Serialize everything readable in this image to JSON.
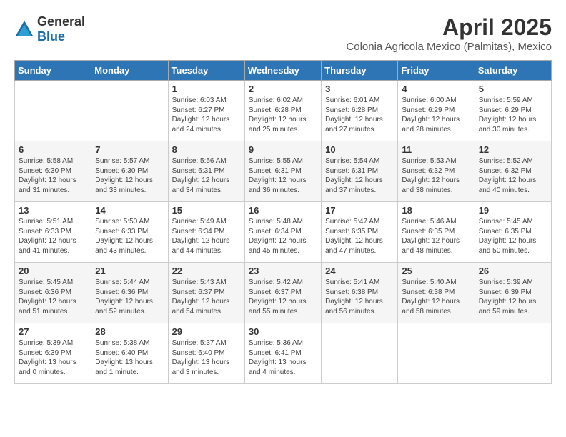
{
  "header": {
    "logo_general": "General",
    "logo_blue": "Blue",
    "month_title": "April 2025",
    "location": "Colonia Agricola Mexico (Palmitas), Mexico"
  },
  "weekdays": [
    "Sunday",
    "Monday",
    "Tuesday",
    "Wednesday",
    "Thursday",
    "Friday",
    "Saturday"
  ],
  "weeks": [
    [
      {
        "day": "",
        "sunrise": "",
        "sunset": "",
        "daylight": ""
      },
      {
        "day": "",
        "sunrise": "",
        "sunset": "",
        "daylight": ""
      },
      {
        "day": "1",
        "sunrise": "Sunrise: 6:03 AM",
        "sunset": "Sunset: 6:27 PM",
        "daylight": "Daylight: 12 hours and 24 minutes."
      },
      {
        "day": "2",
        "sunrise": "Sunrise: 6:02 AM",
        "sunset": "Sunset: 6:28 PM",
        "daylight": "Daylight: 12 hours and 25 minutes."
      },
      {
        "day": "3",
        "sunrise": "Sunrise: 6:01 AM",
        "sunset": "Sunset: 6:28 PM",
        "daylight": "Daylight: 12 hours and 27 minutes."
      },
      {
        "day": "4",
        "sunrise": "Sunrise: 6:00 AM",
        "sunset": "Sunset: 6:29 PM",
        "daylight": "Daylight: 12 hours and 28 minutes."
      },
      {
        "day": "5",
        "sunrise": "Sunrise: 5:59 AM",
        "sunset": "Sunset: 6:29 PM",
        "daylight": "Daylight: 12 hours and 30 minutes."
      }
    ],
    [
      {
        "day": "6",
        "sunrise": "Sunrise: 5:58 AM",
        "sunset": "Sunset: 6:30 PM",
        "daylight": "Daylight: 12 hours and 31 minutes."
      },
      {
        "day": "7",
        "sunrise": "Sunrise: 5:57 AM",
        "sunset": "Sunset: 6:30 PM",
        "daylight": "Daylight: 12 hours and 33 minutes."
      },
      {
        "day": "8",
        "sunrise": "Sunrise: 5:56 AM",
        "sunset": "Sunset: 6:31 PM",
        "daylight": "Daylight: 12 hours and 34 minutes."
      },
      {
        "day": "9",
        "sunrise": "Sunrise: 5:55 AM",
        "sunset": "Sunset: 6:31 PM",
        "daylight": "Daylight: 12 hours and 36 minutes."
      },
      {
        "day": "10",
        "sunrise": "Sunrise: 5:54 AM",
        "sunset": "Sunset: 6:31 PM",
        "daylight": "Daylight: 12 hours and 37 minutes."
      },
      {
        "day": "11",
        "sunrise": "Sunrise: 5:53 AM",
        "sunset": "Sunset: 6:32 PM",
        "daylight": "Daylight: 12 hours and 38 minutes."
      },
      {
        "day": "12",
        "sunrise": "Sunrise: 5:52 AM",
        "sunset": "Sunset: 6:32 PM",
        "daylight": "Daylight: 12 hours and 40 minutes."
      }
    ],
    [
      {
        "day": "13",
        "sunrise": "Sunrise: 5:51 AM",
        "sunset": "Sunset: 6:33 PM",
        "daylight": "Daylight: 12 hours and 41 minutes."
      },
      {
        "day": "14",
        "sunrise": "Sunrise: 5:50 AM",
        "sunset": "Sunset: 6:33 PM",
        "daylight": "Daylight: 12 hours and 43 minutes."
      },
      {
        "day": "15",
        "sunrise": "Sunrise: 5:49 AM",
        "sunset": "Sunset: 6:34 PM",
        "daylight": "Daylight: 12 hours and 44 minutes."
      },
      {
        "day": "16",
        "sunrise": "Sunrise: 5:48 AM",
        "sunset": "Sunset: 6:34 PM",
        "daylight": "Daylight: 12 hours and 45 minutes."
      },
      {
        "day": "17",
        "sunrise": "Sunrise: 5:47 AM",
        "sunset": "Sunset: 6:35 PM",
        "daylight": "Daylight: 12 hours and 47 minutes."
      },
      {
        "day": "18",
        "sunrise": "Sunrise: 5:46 AM",
        "sunset": "Sunset: 6:35 PM",
        "daylight": "Daylight: 12 hours and 48 minutes."
      },
      {
        "day": "19",
        "sunrise": "Sunrise: 5:45 AM",
        "sunset": "Sunset: 6:35 PM",
        "daylight": "Daylight: 12 hours and 50 minutes."
      }
    ],
    [
      {
        "day": "20",
        "sunrise": "Sunrise: 5:45 AM",
        "sunset": "Sunset: 6:36 PM",
        "daylight": "Daylight: 12 hours and 51 minutes."
      },
      {
        "day": "21",
        "sunrise": "Sunrise: 5:44 AM",
        "sunset": "Sunset: 6:36 PM",
        "daylight": "Daylight: 12 hours and 52 minutes."
      },
      {
        "day": "22",
        "sunrise": "Sunrise: 5:43 AM",
        "sunset": "Sunset: 6:37 PM",
        "daylight": "Daylight: 12 hours and 54 minutes."
      },
      {
        "day": "23",
        "sunrise": "Sunrise: 5:42 AM",
        "sunset": "Sunset: 6:37 PM",
        "daylight": "Daylight: 12 hours and 55 minutes."
      },
      {
        "day": "24",
        "sunrise": "Sunrise: 5:41 AM",
        "sunset": "Sunset: 6:38 PM",
        "daylight": "Daylight: 12 hours and 56 minutes."
      },
      {
        "day": "25",
        "sunrise": "Sunrise: 5:40 AM",
        "sunset": "Sunset: 6:38 PM",
        "daylight": "Daylight: 12 hours and 58 minutes."
      },
      {
        "day": "26",
        "sunrise": "Sunrise: 5:39 AM",
        "sunset": "Sunset: 6:39 PM",
        "daylight": "Daylight: 12 hours and 59 minutes."
      }
    ],
    [
      {
        "day": "27",
        "sunrise": "Sunrise: 5:39 AM",
        "sunset": "Sunset: 6:39 PM",
        "daylight": "Daylight: 13 hours and 0 minutes."
      },
      {
        "day": "28",
        "sunrise": "Sunrise: 5:38 AM",
        "sunset": "Sunset: 6:40 PM",
        "daylight": "Daylight: 13 hours and 1 minute."
      },
      {
        "day": "29",
        "sunrise": "Sunrise: 5:37 AM",
        "sunset": "Sunset: 6:40 PM",
        "daylight": "Daylight: 13 hours and 3 minutes."
      },
      {
        "day": "30",
        "sunrise": "Sunrise: 5:36 AM",
        "sunset": "Sunset: 6:41 PM",
        "daylight": "Daylight: 13 hours and 4 minutes."
      },
      {
        "day": "",
        "sunrise": "",
        "sunset": "",
        "daylight": ""
      },
      {
        "day": "",
        "sunrise": "",
        "sunset": "",
        "daylight": ""
      },
      {
        "day": "",
        "sunrise": "",
        "sunset": "",
        "daylight": ""
      }
    ]
  ]
}
